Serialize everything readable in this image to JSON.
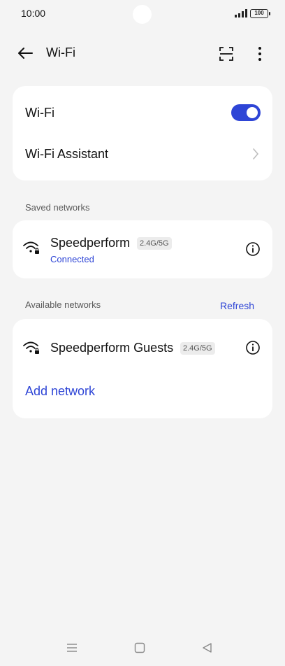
{
  "status_bar": {
    "time": "10:00",
    "battery": "100"
  },
  "header": {
    "title": "Wi-Fi"
  },
  "wifi_card": {
    "wifi_label": "Wi-Fi",
    "wifi_enabled": true,
    "assistant_label": "Wi-Fi Assistant"
  },
  "saved": {
    "section_label": "Saved networks",
    "networks": [
      {
        "name": "Speedperform",
        "band": "2.4G/5G",
        "status": "Connected"
      }
    ]
  },
  "available": {
    "section_label": "Available networks",
    "refresh_label": "Refresh",
    "networks": [
      {
        "name": "Speedperform Guests",
        "band": "2.4G/5G"
      }
    ],
    "add_network_label": "Add network"
  },
  "colors": {
    "accent": "#2e45d6",
    "background": "#f4f4f4",
    "card": "#ffffff"
  },
  "icons": [
    "back-arrow-icon",
    "scan-icon",
    "more-vertical-icon",
    "wifi-lock-icon",
    "info-icon",
    "chevron-right-icon",
    "menu-icon",
    "home-square-icon",
    "back-triangle-icon"
  ]
}
